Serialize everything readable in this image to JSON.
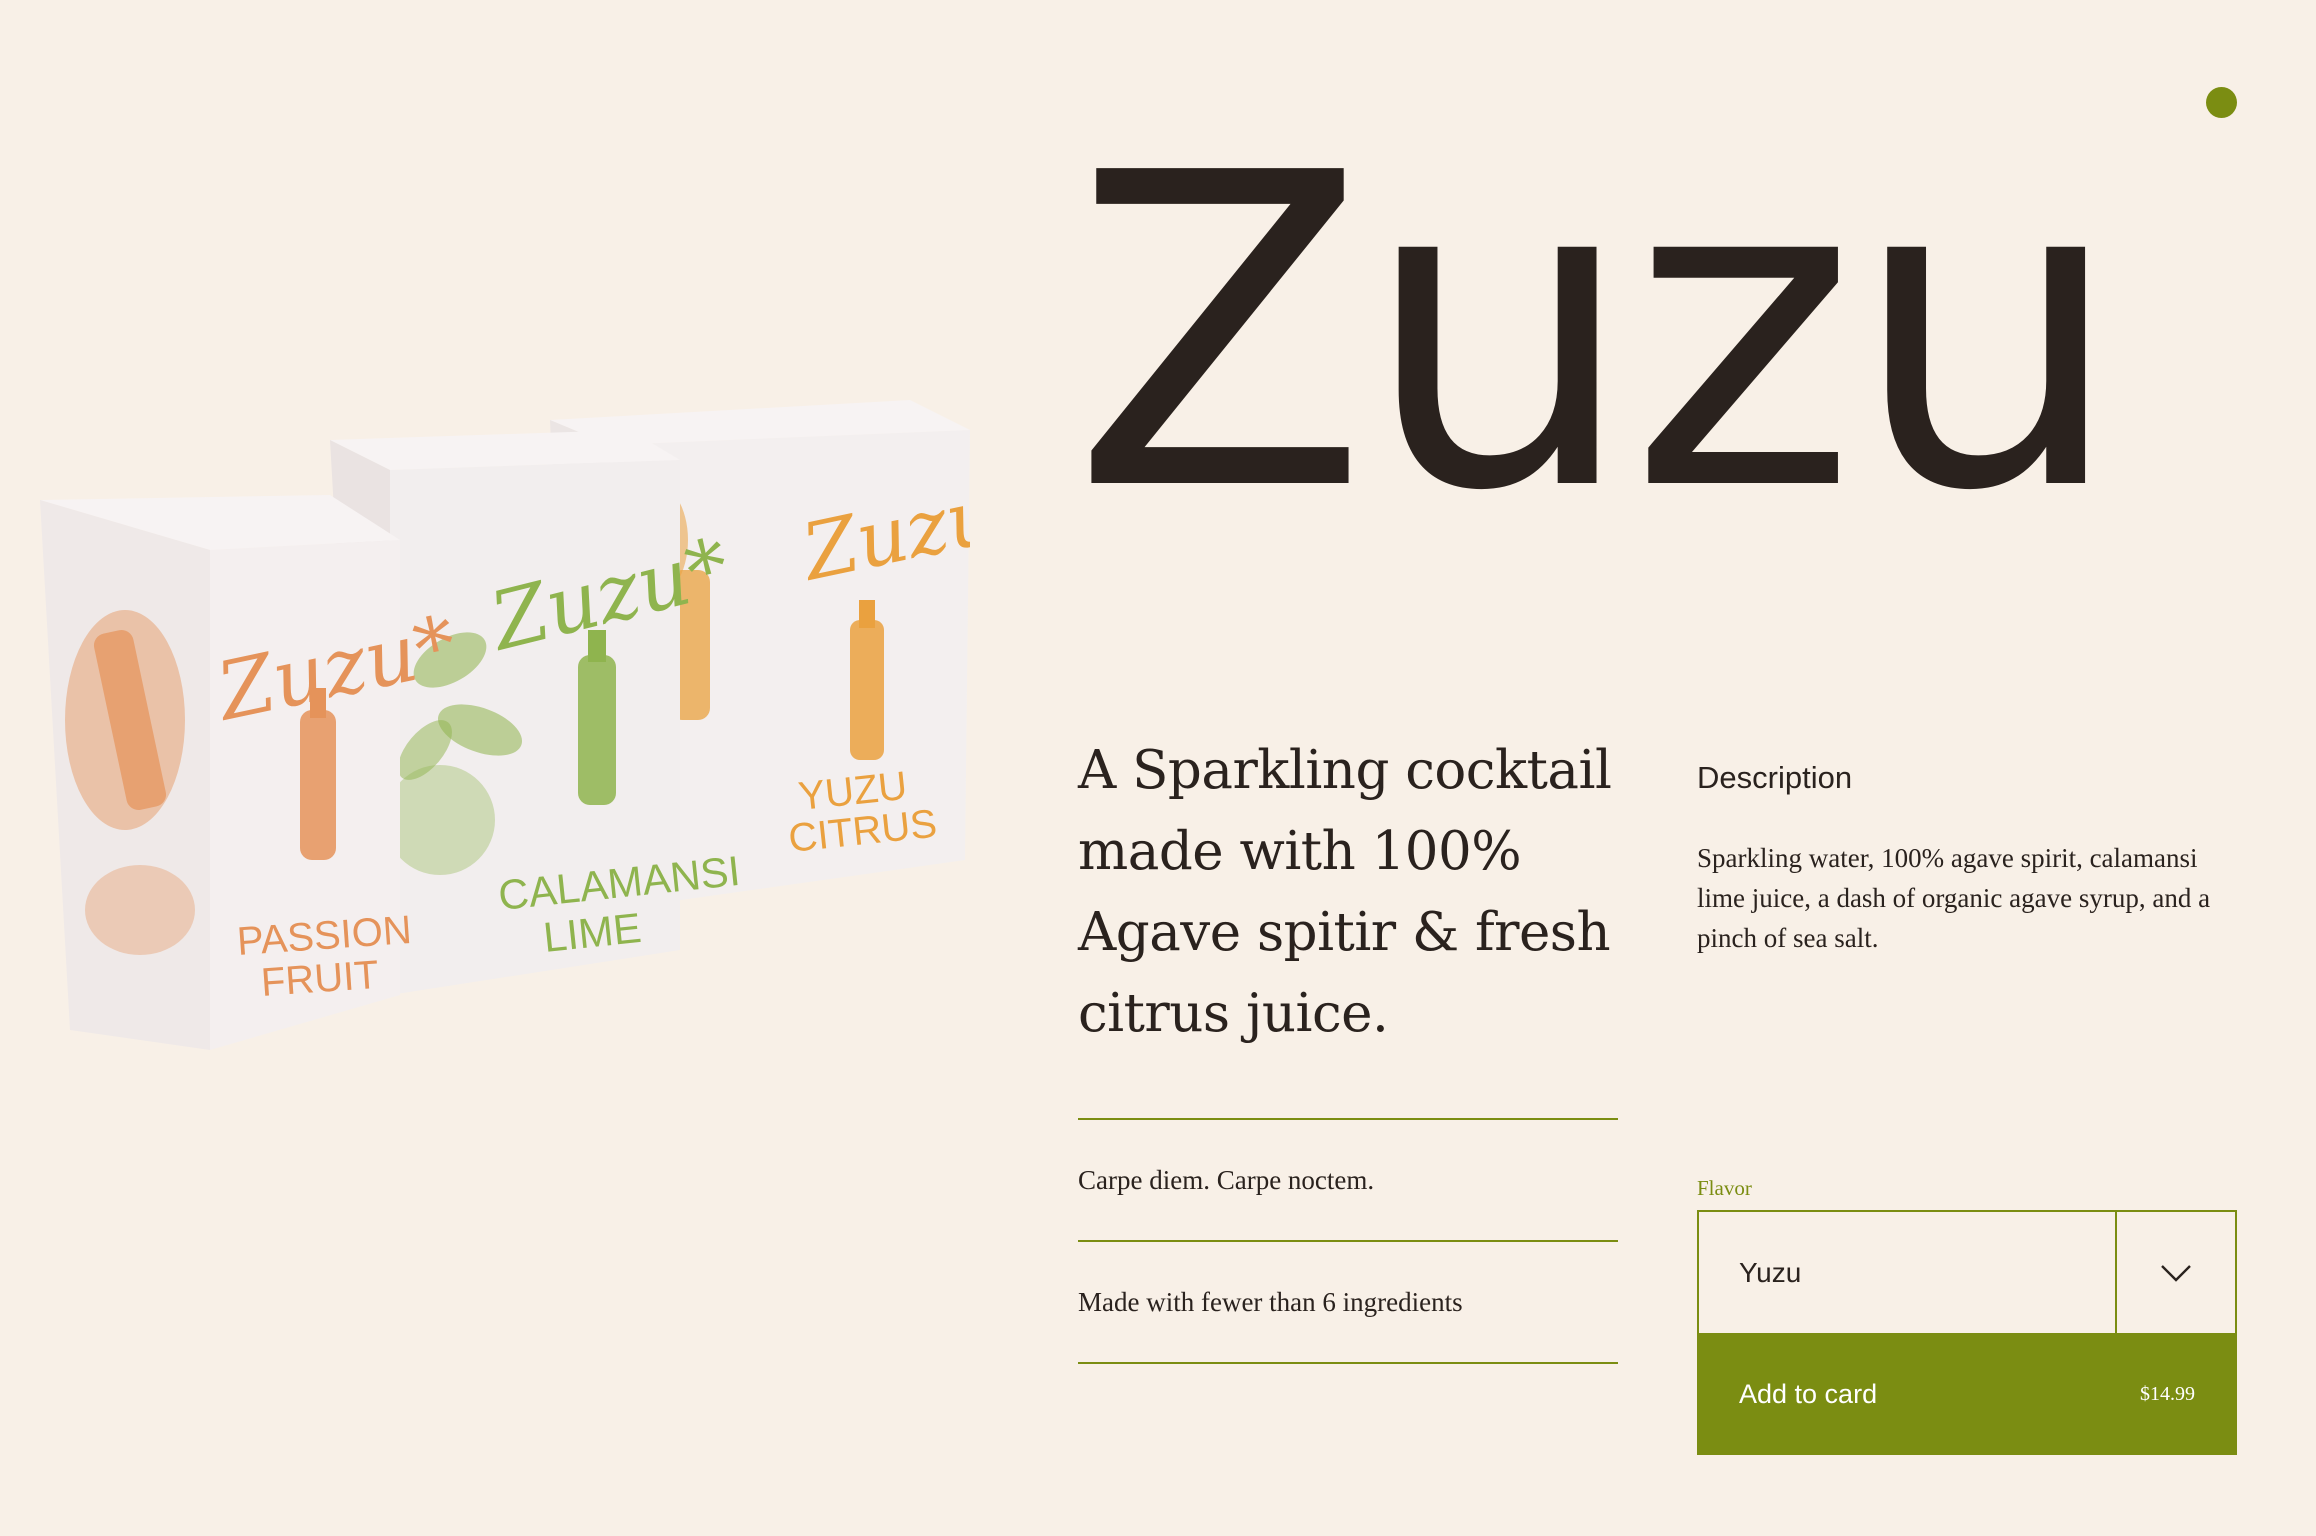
{
  "colors": {
    "background": "#f8f0e7",
    "accent": "#7b8d12",
    "text": "#2a221e",
    "passion_fruit": "#e5935a",
    "calamansi": "#8fb44e",
    "yuzu": "#eaa13f"
  },
  "header": {
    "status_dot_icon": "status-dot-icon"
  },
  "product": {
    "brand": "Zuzu",
    "tagline": "A Sparkling cocktail made with 100% Agave spitir & fresh citrus juice.",
    "description_heading": "Description",
    "description": "Sparkling water, 100% agave spirit, calamansi lime juice, a dash of organic agave syrup, and a pinch of sea salt.",
    "features": [
      "Carpe diem. Carpe noctem.",
      "Made with fewer than 6 ingredients"
    ],
    "packs": [
      {
        "logo": "Zuzu*",
        "flavor_line1": "PASSION",
        "flavor_line2": "FRUIT"
      },
      {
        "logo": "Zuzu*",
        "flavor_line1": "CALAMANSI",
        "flavor_line2": "LIME"
      },
      {
        "logo": "Zuzu*",
        "flavor_line1": "YUZU",
        "flavor_line2": "CITRUS"
      }
    ]
  },
  "purchase": {
    "flavor_label": "Flavor",
    "flavor_selected": "Yuzu",
    "dropdown_icon": "chevron-down-icon",
    "add_to_cart_label": "Add to card",
    "price": "$14.99"
  }
}
